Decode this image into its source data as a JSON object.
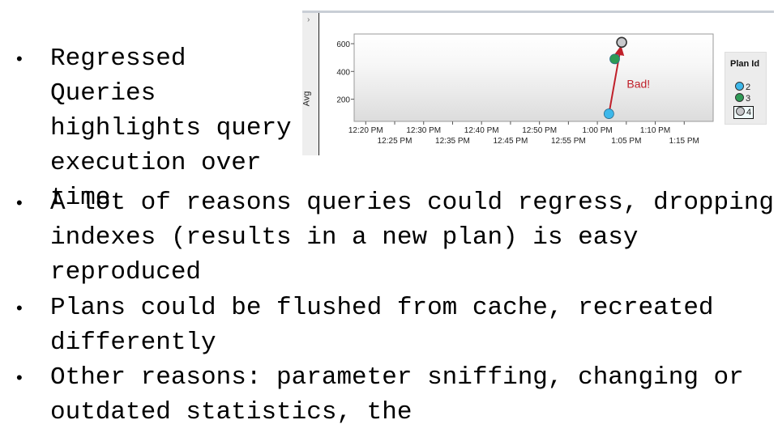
{
  "slide": {
    "bullets": [
      {
        "text": "Regressed Queries highlights query execution over time"
      },
      {
        "text": "A lot of reasons queries could regress, dropping indexes (results in a new plan) is easy reproduced"
      },
      {
        "text": "Plans could be flushed from cache, recreated differently"
      },
      {
        "text": "Other reasons: parameter sniffing, changing or outdated statistics, the"
      }
    ],
    "bullet_glyph": "•"
  },
  "chart_panel": {
    "collapse_glyph": "›",
    "y_axis_label": "Avg",
    "legend_title": "Plan Id",
    "legend": [
      {
        "label": "2",
        "color": "#3db8ea",
        "selected": false
      },
      {
        "label": "3",
        "color": "#2e9a55",
        "selected": false
      },
      {
        "label": "4",
        "color": "#c8c9cc",
        "selected": true
      }
    ],
    "annotation": {
      "text": "Bad!",
      "color": "#c0202a"
    }
  },
  "chart_data": {
    "type": "scatter",
    "title": "",
    "xlabel": "",
    "ylabel": "Avg",
    "y_ticks": [
      200,
      400,
      600
    ],
    "ylim": [
      40,
      670
    ],
    "x_tick_labels_upper": [
      "12:20 PM",
      "12:30 PM",
      "12:40 PM",
      "12:50 PM",
      "1:00 PM",
      "1:10 PM"
    ],
    "x_tick_labels_lower": [
      "12:25 PM",
      "12:35 PM",
      "12:45 PM",
      "12:55 PM",
      "1:05 PM",
      "1:15 PM"
    ],
    "x_range_minutes_from_1220": [
      -2,
      60
    ],
    "series": [
      {
        "name": "Plan 2",
        "color": "#3db8ea",
        "points": [
          {
            "x": "1:02 PM",
            "xm": 42,
            "y": 95
          }
        ]
      },
      {
        "name": "Plan 3",
        "color": "#2e9a55",
        "points": [
          {
            "x": "1:03 PM",
            "xm": 43,
            "y": 490
          }
        ]
      },
      {
        "name": "Plan 4",
        "color": "#c8c9cc",
        "points": [
          {
            "x": "1:04 PM",
            "xm": 44.2,
            "y": 610
          }
        ]
      }
    ],
    "annotation": {
      "text": "Bad!",
      "arrow_from": "Plan 2",
      "arrow_to": "Plan 4"
    },
    "grid": false,
    "legend_position": "right"
  }
}
